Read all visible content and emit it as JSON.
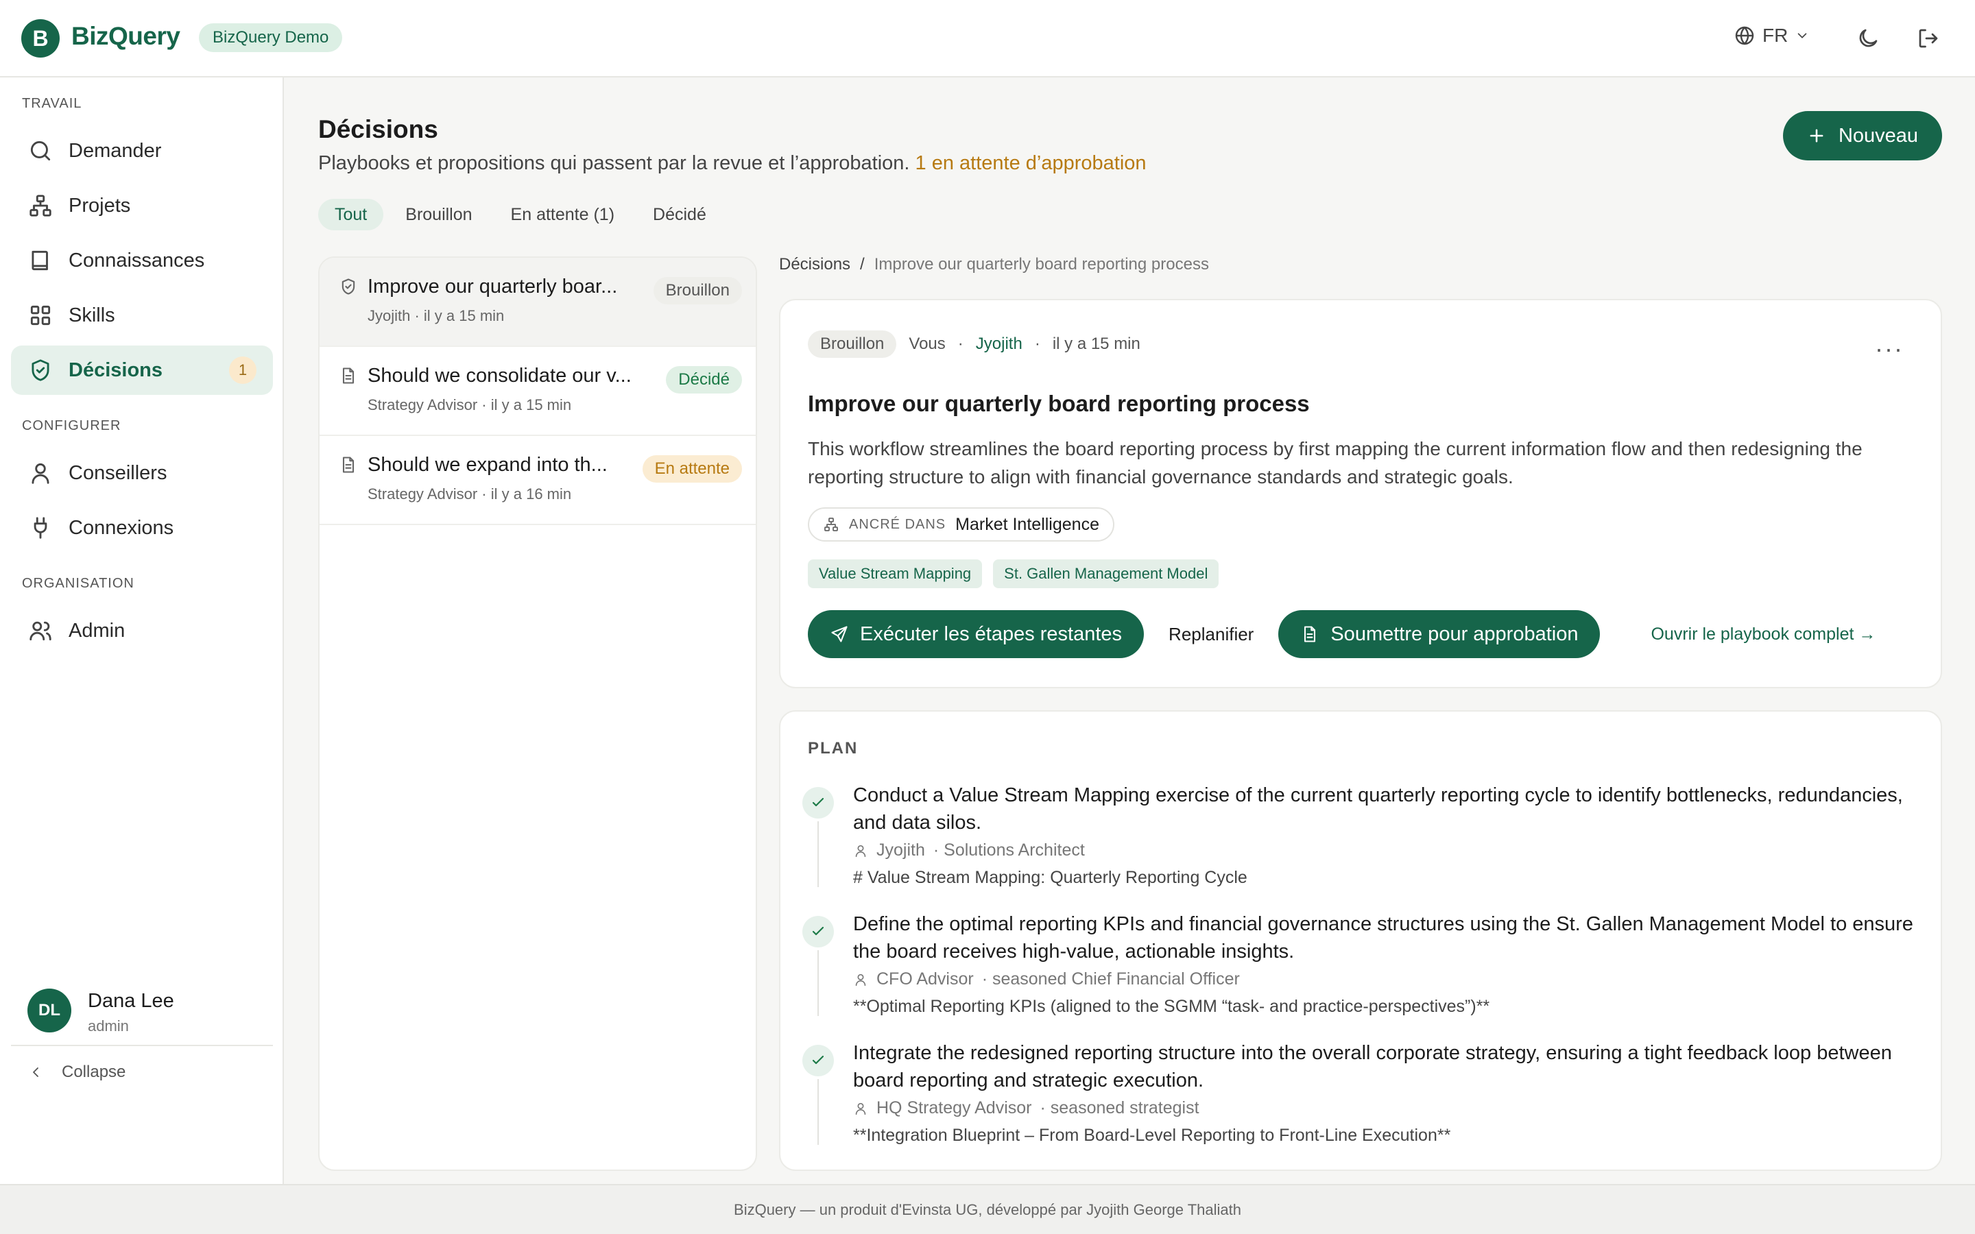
{
  "header": {
    "logo_letter": "B",
    "app_name": "BizQuery",
    "demo_badge": "BizQuery Demo",
    "language": "FR"
  },
  "sidebar": {
    "sections": {
      "work": "TRAVAIL",
      "configure": "CONFIGURER",
      "org": "ORGANISATION"
    },
    "items": [
      {
        "label": "Demander",
        "icon": "search-icon"
      },
      {
        "label": "Projets",
        "icon": "hierarchy-icon"
      },
      {
        "label": "Connaissances",
        "icon": "book-icon"
      },
      {
        "label": "Skills",
        "icon": "grid-icon"
      },
      {
        "label": "Décisions",
        "icon": "shield-check-icon",
        "count": "1",
        "active": true
      },
      {
        "label": "Conseillers",
        "icon": "user-icon"
      },
      {
        "label": "Connexions",
        "icon": "plug-icon"
      },
      {
        "label": "Admin",
        "icon": "users-icon"
      }
    ],
    "user": {
      "initials": "DL",
      "name": "Dana Lee",
      "role": "admin"
    },
    "collapse_label": "Collapse"
  },
  "main": {
    "title": "Décisions",
    "subtitle": "Playbooks et propositions qui passent par la revue et l’approbation.",
    "pending_note": "1 en attente d’approbation",
    "new_button": "Nouveau",
    "tabs": [
      "Tout",
      "Brouillon",
      "En attente (1)",
      "Décidé"
    ],
    "list": [
      {
        "title": "Improve our quarterly boar...",
        "meta": "Jyojith · il y a 15 min",
        "status": "Brouillon"
      },
      {
        "title": "Should we consolidate our v...",
        "meta": "Strategy Advisor · il y a 15 min",
        "status": "Décidé"
      },
      {
        "title": "Should we expand into th...",
        "meta": "Strategy Advisor · il y a 16 min",
        "status": "En attente"
      }
    ]
  },
  "detail": {
    "breadcrumb": {
      "root": "Décisions",
      "separator": "/",
      "current": "Improve our quarterly board reporting process"
    },
    "status": "Brouillon",
    "by_label": "Vous",
    "owner": "Jyojith",
    "time": "il y a 15 min",
    "more": "···",
    "title": "Improve our quarterly board reporting process",
    "description": "This workflow streamlines the board reporting process by first mapping the current information flow and then redesigning the reporting structure to align with financial governance standards and strategic goals.",
    "anchor_label": "ANCRÉ DANS",
    "anchor_value": "Market Intelligence",
    "chips": [
      "Value Stream Mapping",
      "St. Gallen Management Model"
    ],
    "actions": {
      "run": "Exécuter les étapes restantes",
      "replan": "Replanifier",
      "submit": "Soumettre pour approbation",
      "open": "Ouvrir le playbook complet →"
    }
  },
  "plan": {
    "label": "PLAN",
    "steps": [
      {
        "text": "Conduct a Value Stream Mapping exercise of the current quarterly reporting cycle to identify bottlenecks, redundancies, and data silos.",
        "who": "Jyojith",
        "role": "· Solutions Architect",
        "output": "# Value Stream Mapping: Quarterly Reporting Cycle"
      },
      {
        "text": "Define the optimal reporting KPIs and financial governance structures using the St. Gallen Management Model to ensure the board receives high-value, actionable insights.",
        "who": "CFO Advisor",
        "role": "· seasoned Chief Financial Officer",
        "output": "**Optimal Reporting KPIs (aligned to the SGMM “task- and practice-perspectives”)**"
      },
      {
        "text": "Integrate the redesigned reporting structure into the overall corporate strategy, ensuring a tight feedback loop between board reporting and strategic execution.",
        "who": "HQ Strategy Advisor",
        "role": "· seasoned strategist",
        "output": "**Integration Blueprint – From Board-Level Reporting to Front-Line Execution**"
      }
    ]
  },
  "footer": "BizQuery — un produit d'Evinsta UG, développé par Jyojith George Thaliath",
  "colors": {
    "brand": "#16654a",
    "pending": "#b77a12",
    "decided": "#1c7a47"
  }
}
